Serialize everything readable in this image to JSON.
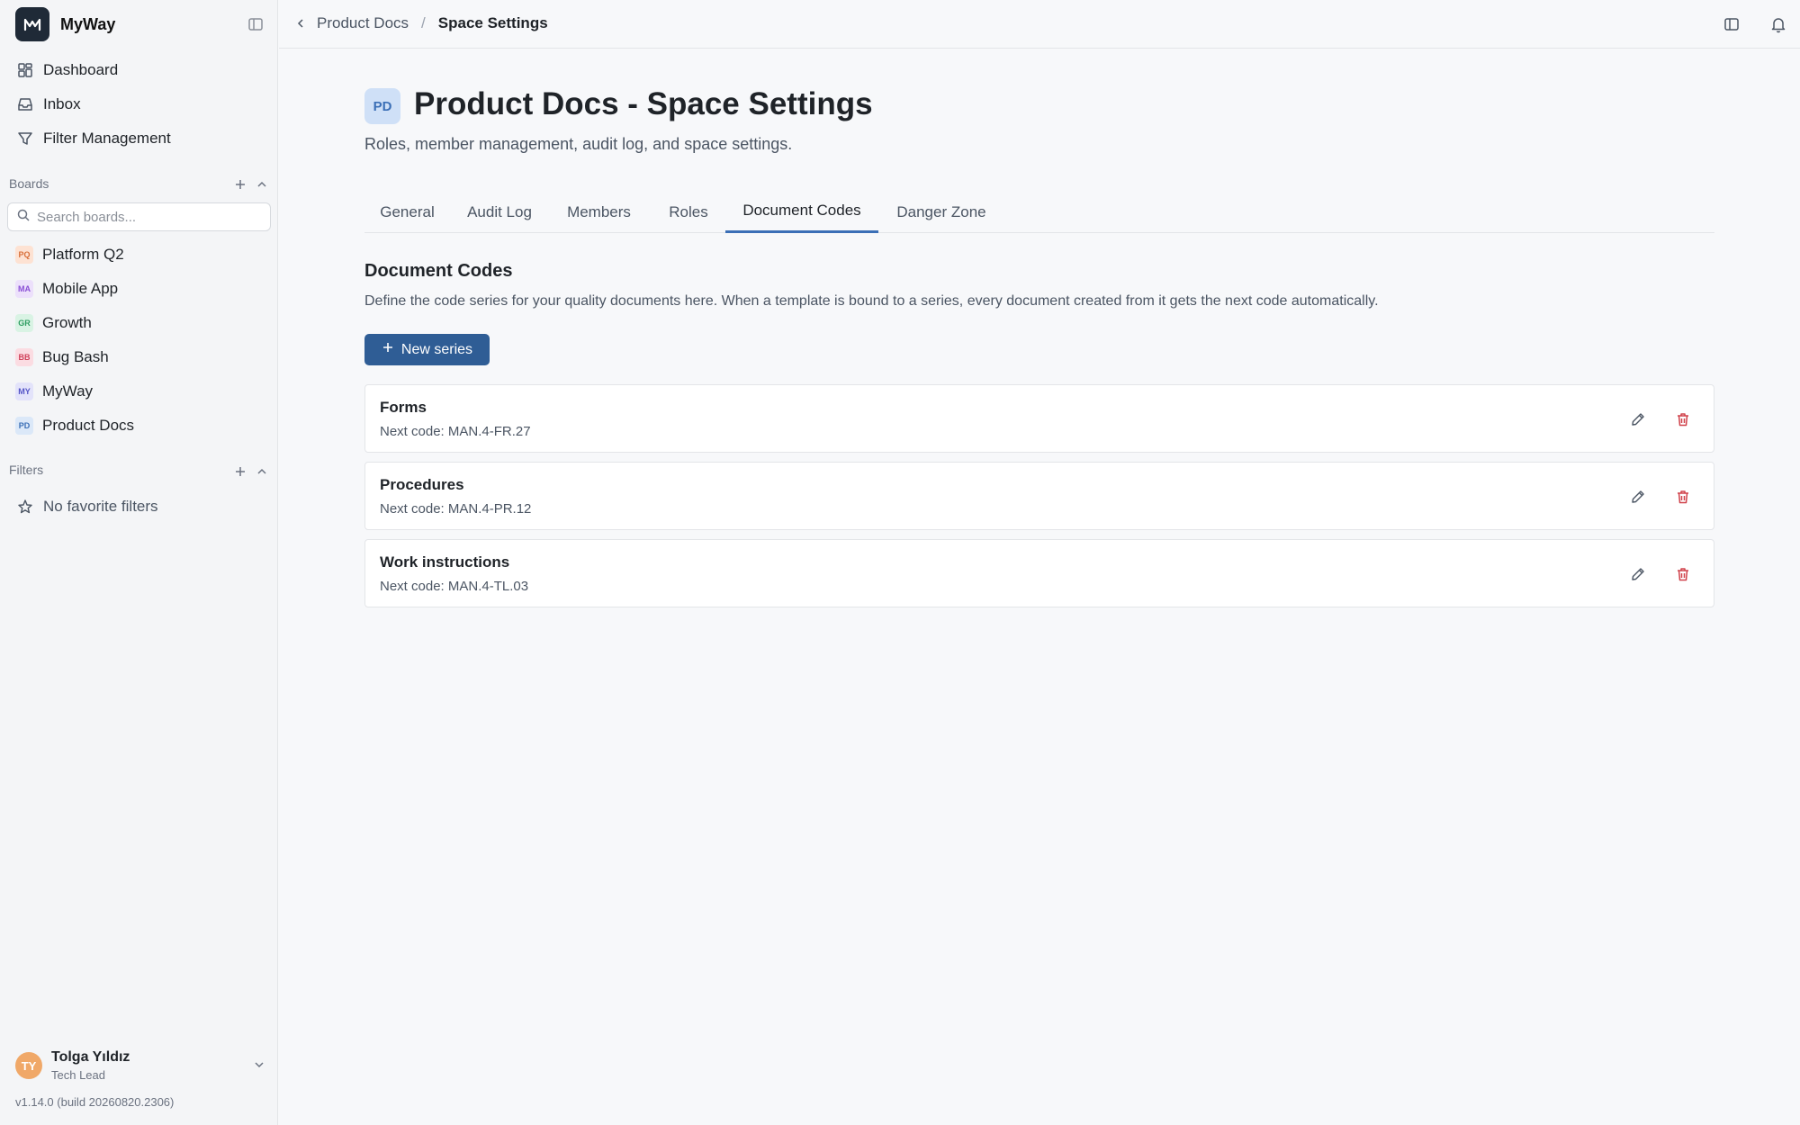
{
  "app": {
    "name": "MyWay",
    "version": "v1.14.0 (build 20260820.2306)"
  },
  "sidebar": {
    "nav": [
      {
        "label": "Dashboard",
        "icon": "dashboard-icon"
      },
      {
        "label": "Inbox",
        "icon": "inbox-icon"
      },
      {
        "label": "Filter Management",
        "icon": "filter-icon"
      }
    ],
    "boards_label": "Boards",
    "search_placeholder": "Search boards...",
    "boards": [
      {
        "badge": "PQ",
        "label": "Platform Q2",
        "bg": "#fde2d3",
        "fg": "#d8703b"
      },
      {
        "badge": "MA",
        "label": "Mobile App",
        "bg": "#ece0fb",
        "fg": "#8a4fd6"
      },
      {
        "badge": "GR",
        "label": "Growth",
        "bg": "#d9f3e4",
        "fg": "#2f9e62"
      },
      {
        "badge": "BB",
        "label": "Bug Bash",
        "bg": "#fbdce2",
        "fg": "#d0425b"
      },
      {
        "badge": "MY",
        "label": "MyWay",
        "bg": "#e3e3fa",
        "fg": "#5656c7"
      },
      {
        "badge": "PD",
        "label": "Product Docs",
        "bg": "#dbe8f8",
        "fg": "#3b6fb6"
      }
    ],
    "filters_label": "Filters",
    "no_filters": "No favorite filters"
  },
  "user": {
    "initials": "TY",
    "name": "Tolga Yıldız",
    "role": "Tech Lead"
  },
  "breadcrumb": {
    "parent": "Product Docs",
    "separator": "/",
    "current": "Space Settings"
  },
  "page": {
    "badge": "PD",
    "title": "Product Docs - Space Settings",
    "subtitle": "Roles, member management, audit log, and space settings."
  },
  "tabs": [
    {
      "label": "General",
      "active": false
    },
    {
      "label": "Audit Log",
      "active": false
    },
    {
      "label": "Members",
      "active": false
    },
    {
      "label": "Roles",
      "active": false
    },
    {
      "label": "Document Codes",
      "active": true
    },
    {
      "label": "Danger Zone",
      "active": false
    }
  ],
  "doc_codes": {
    "title": "Document Codes",
    "description": "Define the code series for your quality documents here. When a template is bound to a series, every document created from it gets the next code automatically.",
    "new_label": "New series",
    "series": [
      {
        "name": "Forms",
        "next": "Next code: MAN.4-FR.27"
      },
      {
        "name": "Procedures",
        "next": "Next code: MAN.4-PR.12"
      },
      {
        "name": "Work instructions",
        "next": "Next code: MAN.4-TL.03"
      }
    ]
  },
  "colors": {
    "accent": "#2f5d95",
    "danger": "#d0424b",
    "tab_underline": "#3b6fb6"
  }
}
